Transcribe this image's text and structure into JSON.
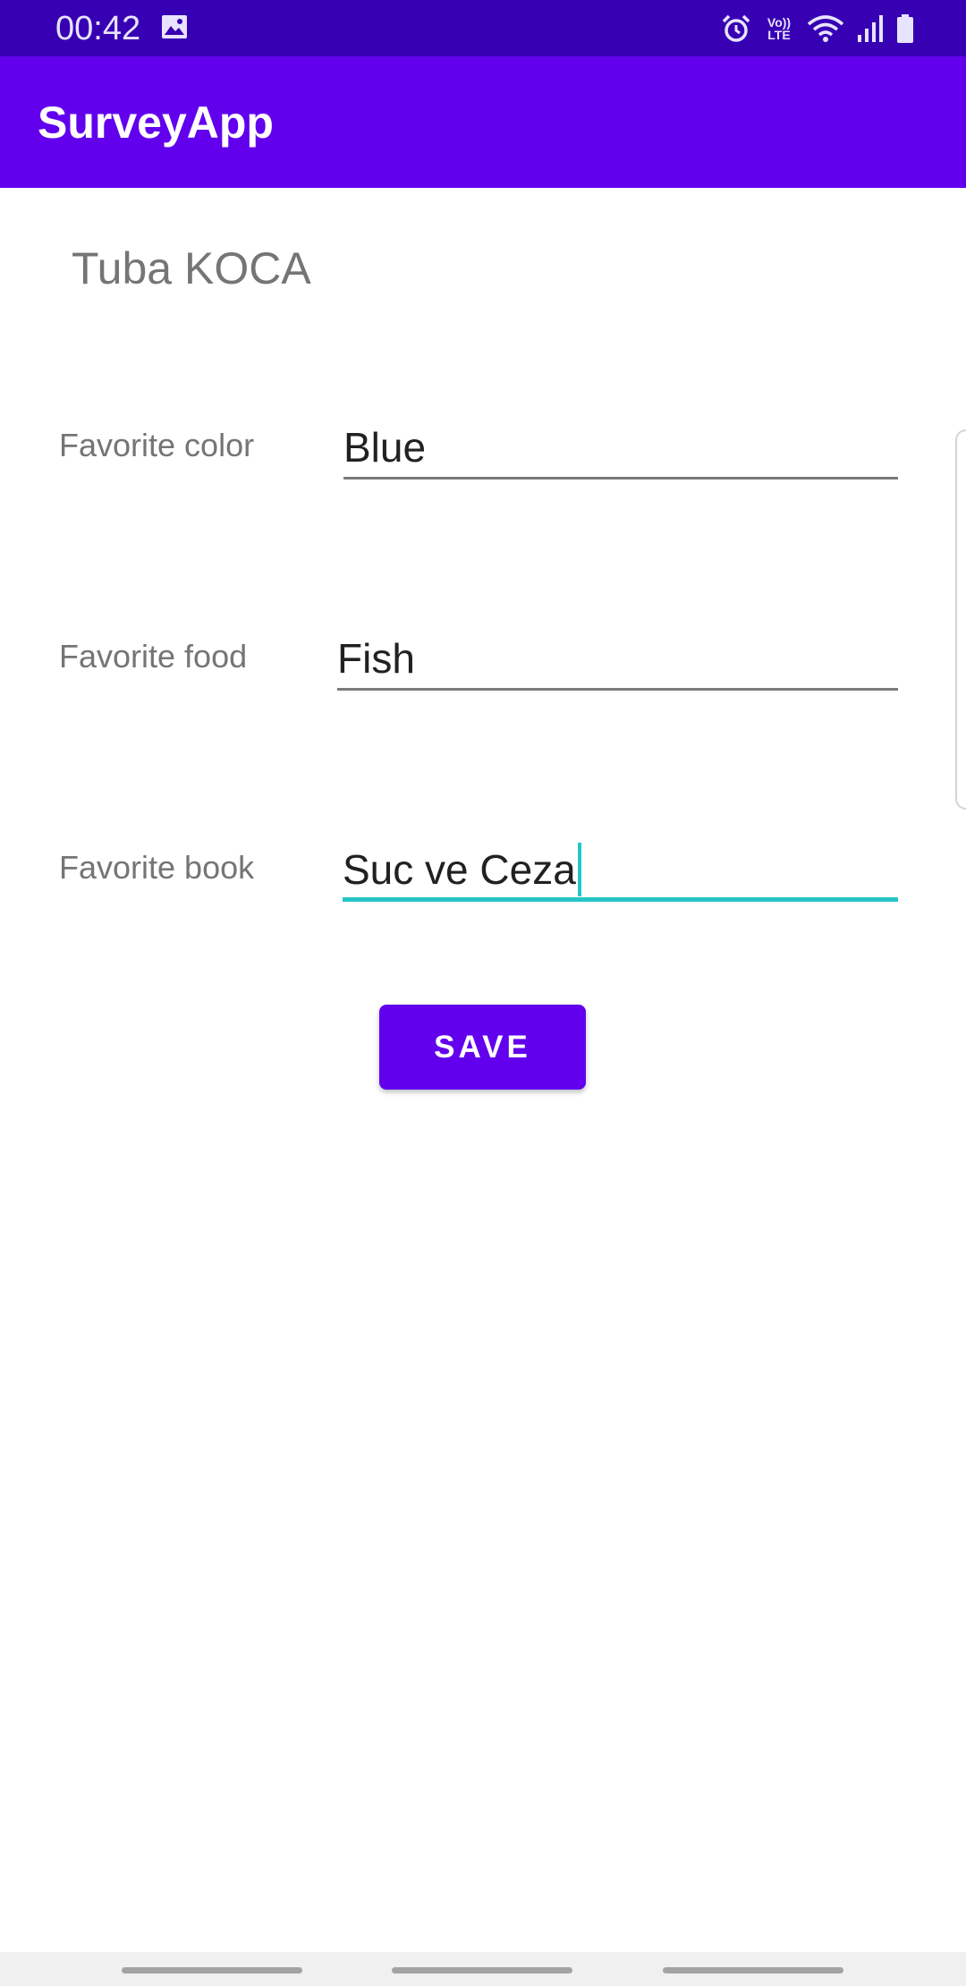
{
  "status_bar": {
    "time": "00:42",
    "volte_top": "Vo))",
    "volte_bottom": "LTE",
    "icons": [
      "gallery-icon",
      "alarm-icon",
      "volte-icon",
      "wifi-icon",
      "signal-icon",
      "battery-icon"
    ]
  },
  "app_bar": {
    "title": "SurveyApp"
  },
  "user": {
    "name": "Tuba KOCA"
  },
  "fields": [
    {
      "label": "Favorite color",
      "value": "Blue"
    },
    {
      "label": "Favorite food",
      "value": "Fish"
    },
    {
      "label": "Favorite book",
      "value": "Suc ve Ceza"
    }
  ],
  "actions": {
    "save_label": "SAVE"
  },
  "colors": {
    "status_bar": "#3700b3",
    "primary": "#6200ee",
    "focus_accent": "#26c6c6"
  }
}
